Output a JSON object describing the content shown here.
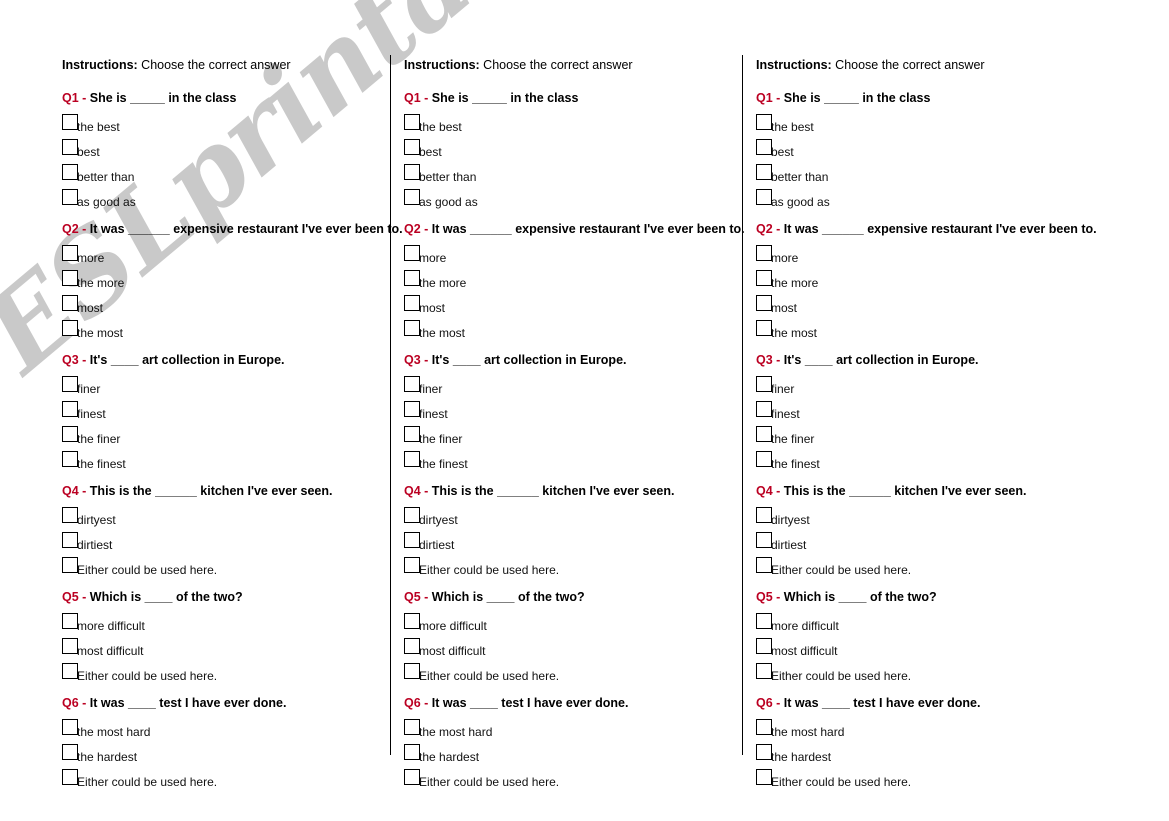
{
  "watermark": {
    "text": "ESLprintables.com",
    "color": "#c9c9c9"
  },
  "accent_color": "#bb0022",
  "instructions": {
    "label": "Instructions:",
    "text": " Choose the correct answer"
  },
  "questions": [
    {
      "num": "Q1",
      "dash": " - ",
      "text": "She is _____ in the class",
      "options": [
        "the best",
        "best",
        "better than",
        "as good as"
      ]
    },
    {
      "num": "Q2",
      "dash": " - ",
      "text": "It was ______ expensive restaurant I've ever been to.",
      "options": [
        "more",
        "the more",
        "most",
        "the most"
      ]
    },
    {
      "num": "Q3",
      "dash": " - ",
      "text": "It's ____ art collection in Europe.",
      "options": [
        "finer",
        "finest",
        "the finer",
        "the finest"
      ]
    },
    {
      "num": "Q4",
      "dash": " - ",
      "text": "This is the ______ kitchen I've ever seen.",
      "options": [
        "dirtyest",
        "dirtiest",
        "Either could be used here."
      ]
    },
    {
      "num": "Q5",
      "dash": " - ",
      "text": "Which is ____ of the two?",
      "options": [
        "more difficult",
        "most difficult",
        "Either could be used here."
      ]
    },
    {
      "num": "Q6",
      "dash": " - ",
      "text": "It was ____ test I have ever done.",
      "options": [
        "the most hard",
        "the hardest",
        "Either could be used here."
      ]
    }
  ],
  "columns": [
    {
      "id": "column-0"
    },
    {
      "id": "column-1"
    },
    {
      "id": "column-2"
    }
  ]
}
